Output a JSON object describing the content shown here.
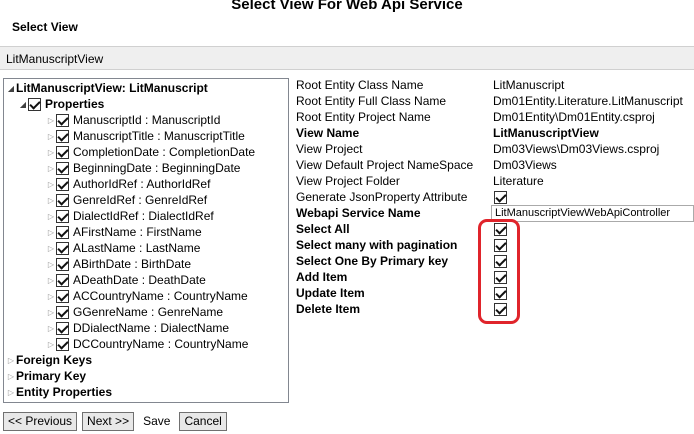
{
  "window": {
    "title": "Select View For Web Api Service"
  },
  "select_view": {
    "label": "Select View",
    "value": "LitManuscriptView"
  },
  "tree": {
    "root": "LitManuscriptView: LitManuscript",
    "properties_label": "Properties",
    "properties": [
      "ManuscriptId : ManuscriptId",
      "ManuscriptTitle : ManuscriptTitle",
      "CompletionDate : CompletionDate",
      "BeginningDate : BeginningDate",
      "AuthorIdRef : AuthorIdRef",
      "GenreIdRef : GenreIdRef",
      "DialectIdRef : DialectIdRef",
      "AFirstName : FirstName",
      "ALastName : LastName",
      "ABirthDate : BirthDate",
      "ADeathDate : DeathDate",
      "ACCountryName : CountryName",
      "GGenreName : GenreName",
      "DDialectName : DialectName",
      "DCCountryName : CountryName"
    ],
    "foreign_keys": "Foreign Keys",
    "primary_key": "Primary Key",
    "entity_properties": "Entity Properties"
  },
  "details": {
    "root_entity_class_label": "Root Entity Class Name",
    "root_entity_class_value": "LitManuscript",
    "root_entity_full_label": "Root Entity Full Class Name",
    "root_entity_full_value": "Dm01Entity.Literature.LitManuscript",
    "root_entity_project_label": "Root Entity Project Name",
    "root_entity_project_value": "Dm01Entity\\Dm01Entity.csproj",
    "view_name_label": "View Name",
    "view_name_value": "LitManuscriptView",
    "view_project_label": "View Project",
    "view_project_value": "Dm03Views\\Dm03Views.csproj",
    "view_ns_label": "View Default Project NameSpace",
    "view_ns_value": "Dm03Views",
    "view_folder_label": "View Project Folder",
    "view_folder_value": "Literature",
    "gen_json_label": "Generate JsonProperty Attribute",
    "webapi_name_label": "Webapi Service Name",
    "webapi_name_value": "LitManuscriptViewWebApiController",
    "select_all_label": "Select All",
    "select_many_label": "Select many with pagination",
    "select_one_label": "Select One By Primary key",
    "add_item_label": "Add Item",
    "update_item_label": "Update Item",
    "delete_item_label": "Delete Item"
  },
  "footer": {
    "previous": "<< Previous",
    "next": "Next >>",
    "save": "Save",
    "cancel": "Cancel"
  },
  "colors": {
    "highlight": "#e0242b"
  }
}
